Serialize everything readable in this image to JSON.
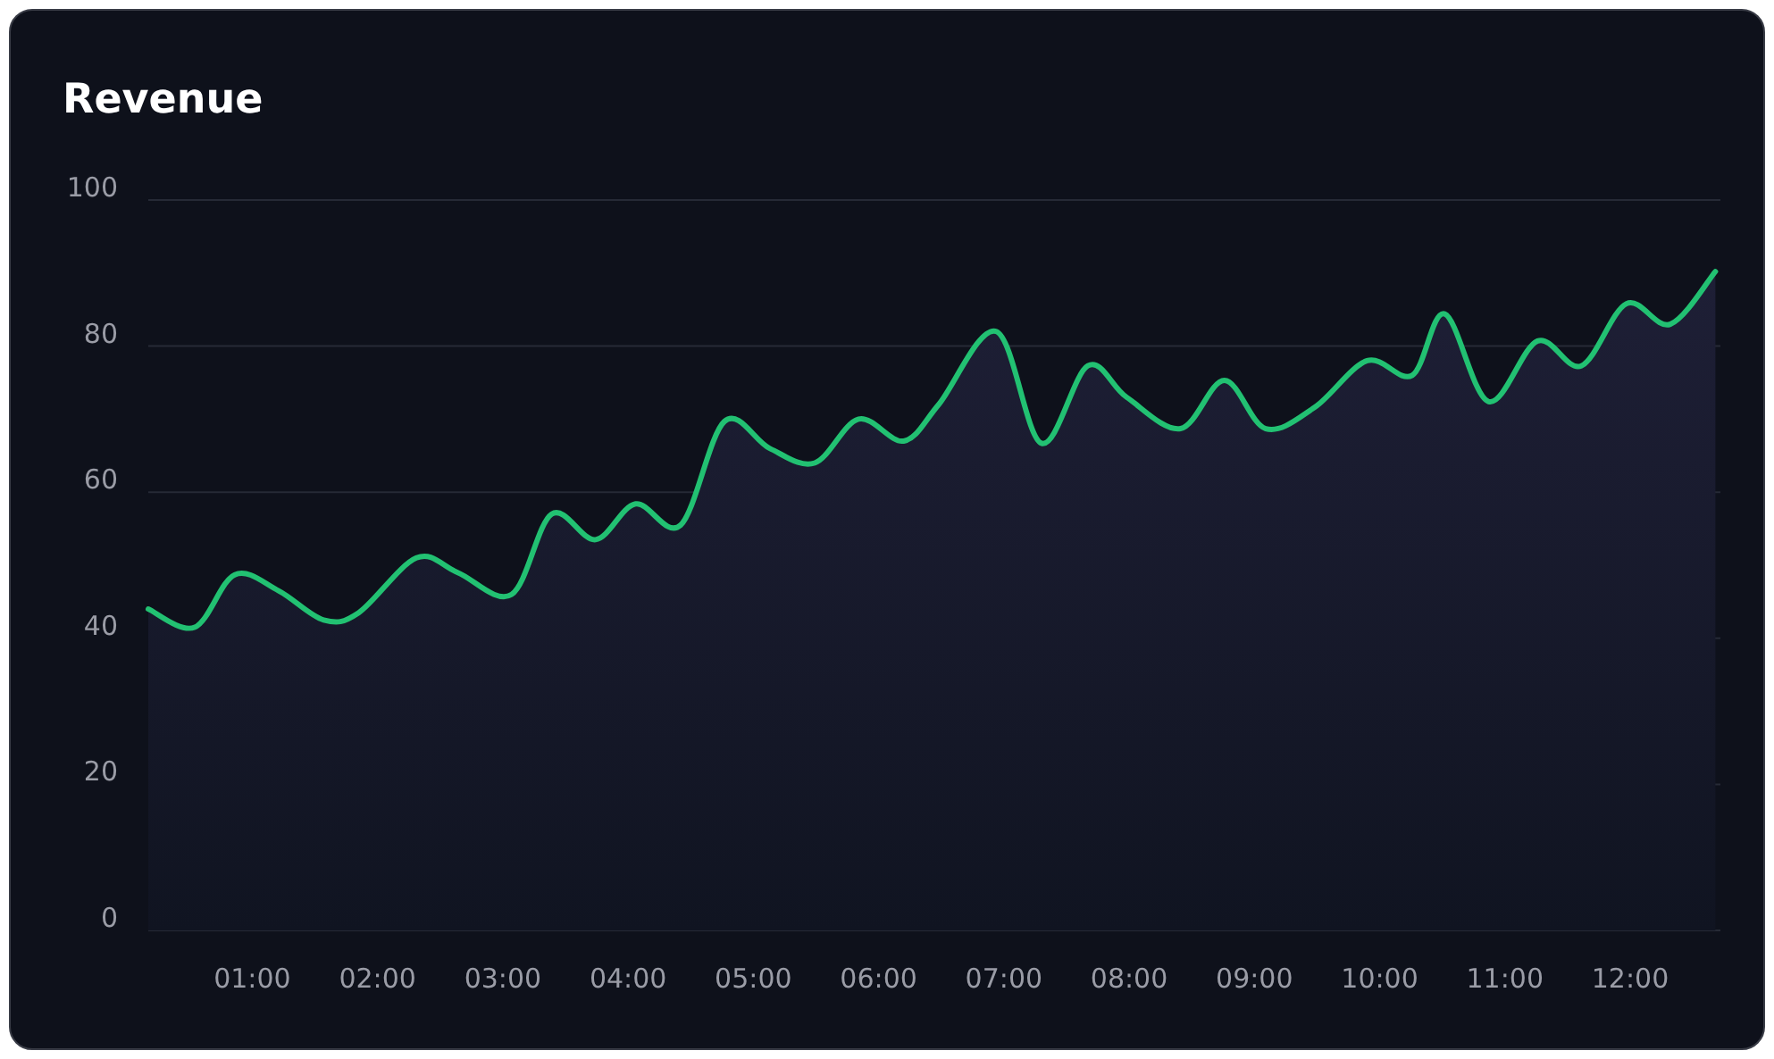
{
  "card": {
    "chart_data": {
      "type": "area",
      "title": "Revenue",
      "grid": true,
      "x": [
        0.17,
        0.54,
        0.86,
        1.21,
        1.57,
        1.85,
        2.31,
        2.64,
        3.07,
        3.39,
        3.74,
        4.06,
        4.42,
        4.77,
        5.13,
        5.49,
        5.84,
        6.2,
        6.48,
        6.94,
        7.3,
        7.67,
        7.98,
        8.41,
        8.76,
        9.09,
        9.48,
        9.9,
        10.26,
        10.52,
        10.87,
        11.26,
        11.61,
        11.97,
        12.32,
        12.68
      ],
      "series": [
        {
          "color": "#22c172",
          "values": [
            44,
            41.5,
            48.7,
            46.5,
            42.5,
            43.5,
            51,
            49,
            46,
            57,
            53.5,
            58.4,
            55.5,
            69.7,
            66,
            64,
            70,
            67,
            72,
            82,
            66.7,
            77.3,
            73,
            68.7,
            75.3,
            68.7,
            71.6,
            78,
            76,
            84.4,
            72.4,
            80.7,
            77.3,
            85.8,
            83,
            90.2
          ]
        }
      ],
      "xlim": [
        0.17,
        12.72
      ],
      "ylim": [
        0,
        100
      ],
      "xticks": [
        {
          "value": 1,
          "label": "01:00"
        },
        {
          "value": 2,
          "label": "02:00"
        },
        {
          "value": 3,
          "label": "03:00"
        },
        {
          "value": 4,
          "label": "04:00"
        },
        {
          "value": 5,
          "label": "05:00"
        },
        {
          "value": 6,
          "label": "06:00"
        },
        {
          "value": 7,
          "label": "07:00"
        },
        {
          "value": 8,
          "label": "08:00"
        },
        {
          "value": 9,
          "label": "09:00"
        },
        {
          "value": 10,
          "label": "10:00"
        },
        {
          "value": 11,
          "label": "11:00"
        },
        {
          "value": 12,
          "label": "12:00"
        }
      ],
      "yticks": [
        0,
        20,
        40,
        60,
        80,
        100
      ]
    }
  }
}
